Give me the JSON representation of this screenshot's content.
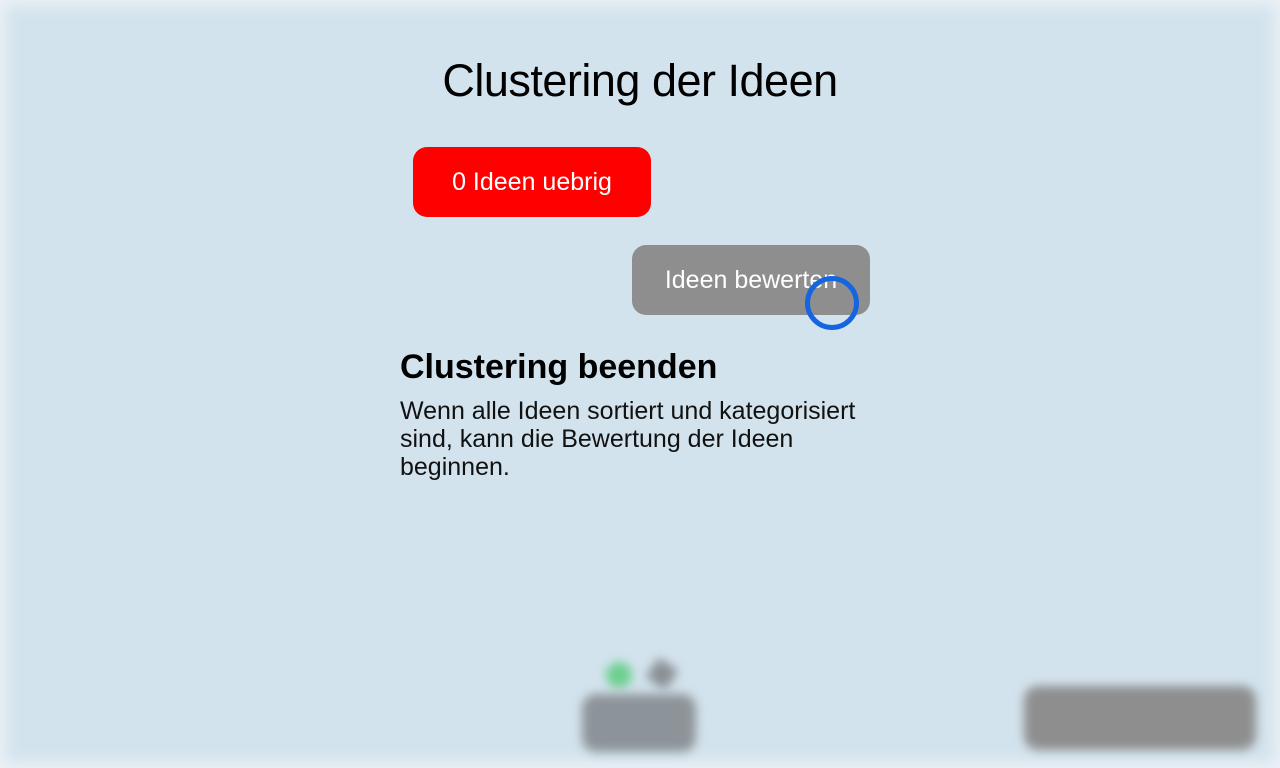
{
  "page": {
    "title": "Clustering der Ideen"
  },
  "buttons": {
    "ideas_remaining_label": "0 Ideen uebrig",
    "rate_ideas_label": "Ideen bewerten"
  },
  "info": {
    "heading": "Clustering beenden",
    "body": "Wenn alle Ideen sortiert und kategorisiert sind, kann die Bewertung der Ideen beginnen."
  },
  "colors": {
    "background": "#d3e3ed",
    "ideas_remaining_bg": "#ff0000",
    "rate_button_bg": "#8e8e8e",
    "cursor_ring": "#1565e0"
  },
  "icons": [
    "check-icon",
    "edit-icon"
  ]
}
